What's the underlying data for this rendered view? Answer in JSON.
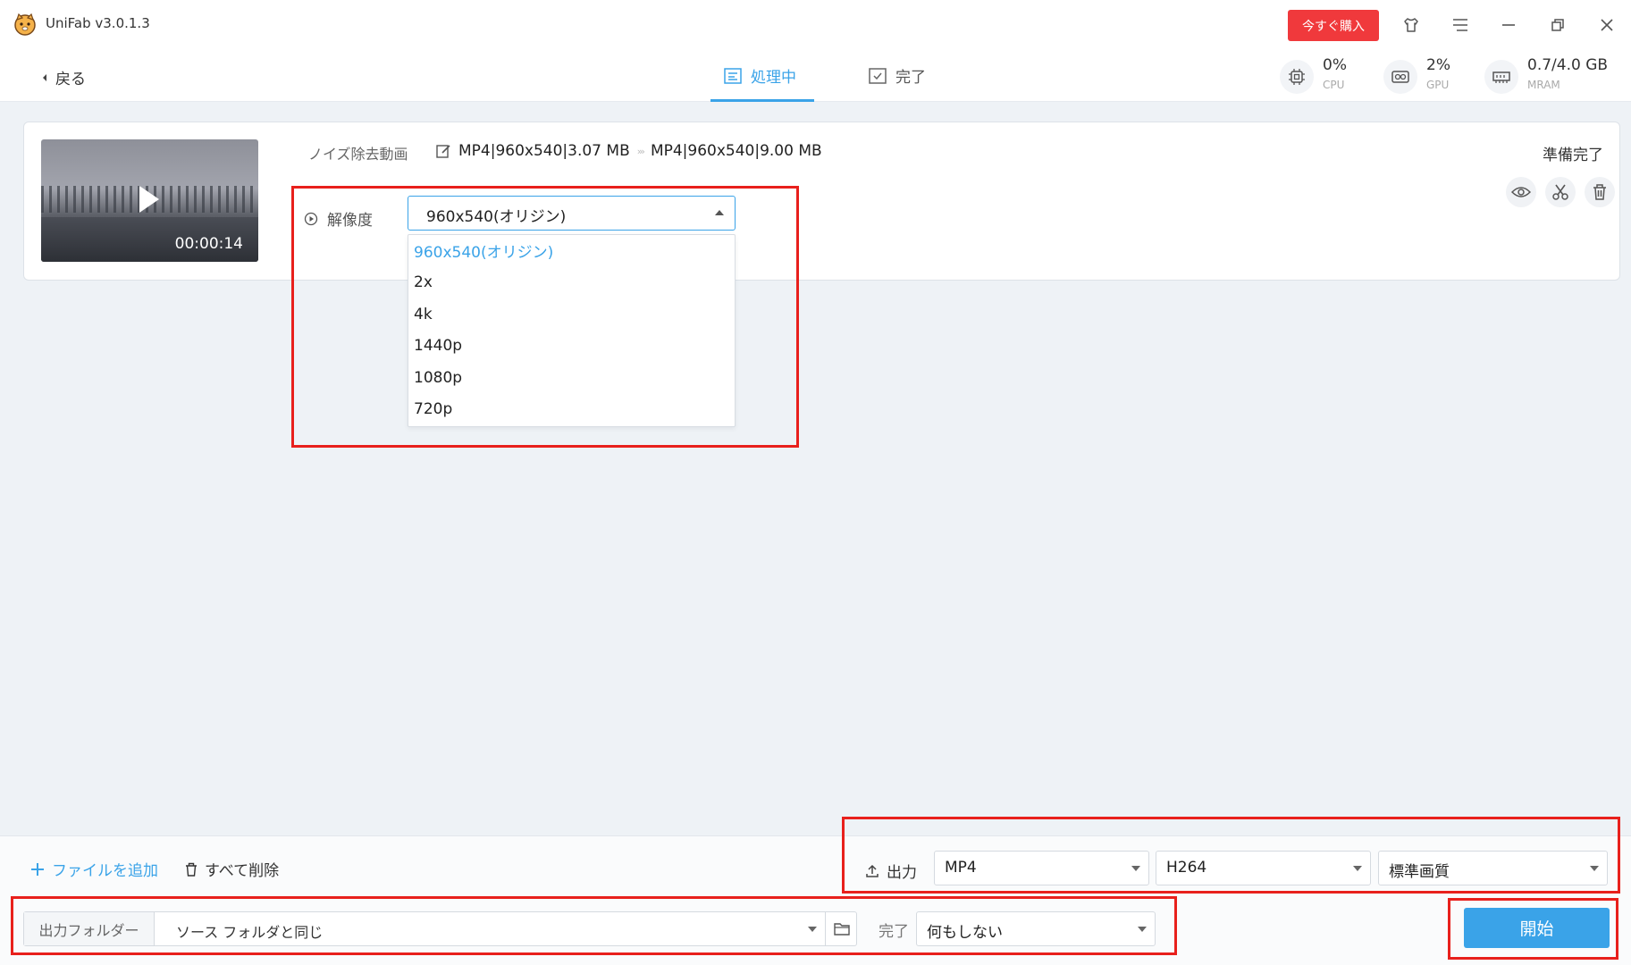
{
  "window": {
    "title": "UniFab v3.0.1.3",
    "buy_label": "今すぐ購入",
    "icons": [
      "shirt-icon",
      "menu-icon",
      "minimize-icon",
      "restore-icon",
      "close-icon"
    ]
  },
  "nav": {
    "back_label": "戻る",
    "tabs": [
      {
        "label": "処理中",
        "active": true
      },
      {
        "label": "完了",
        "active": false
      }
    ],
    "stats": [
      {
        "value": "0%",
        "label": "CPU"
      },
      {
        "value": "2%",
        "label": "GPU"
      },
      {
        "value": "0.7/4.0 GB",
        "label": "MRAM"
      }
    ]
  },
  "task": {
    "duration": "00:00:14",
    "name": "ノイズ除去動画",
    "input_info": "MP4|960x540|3.07 MB",
    "output_info": "MP4|960x540|9.00 MB",
    "status": "準備完了",
    "resolution_label": "解像度",
    "resolution_selected": "960x540(オリジン)",
    "resolution_options": [
      "960x540(オリジン)",
      "2x",
      "4k",
      "1440p",
      "1080p",
      "720p"
    ]
  },
  "bottom": {
    "add_file_label": "ファイルを追加",
    "delete_all_label": "すべて削除",
    "output_label": "出力",
    "format_value": "MP4",
    "codec_value": "H264",
    "quality_value": "標準画質",
    "folder_label": "出力フォルダー",
    "folder_value": "ソース フォルダと同じ",
    "done_label": "完了",
    "done_value": "何もしない",
    "start_label": "開始"
  },
  "colors": {
    "accent": "#3aa3e8",
    "buy": "#f0393c",
    "annotation": "#e8201c"
  }
}
